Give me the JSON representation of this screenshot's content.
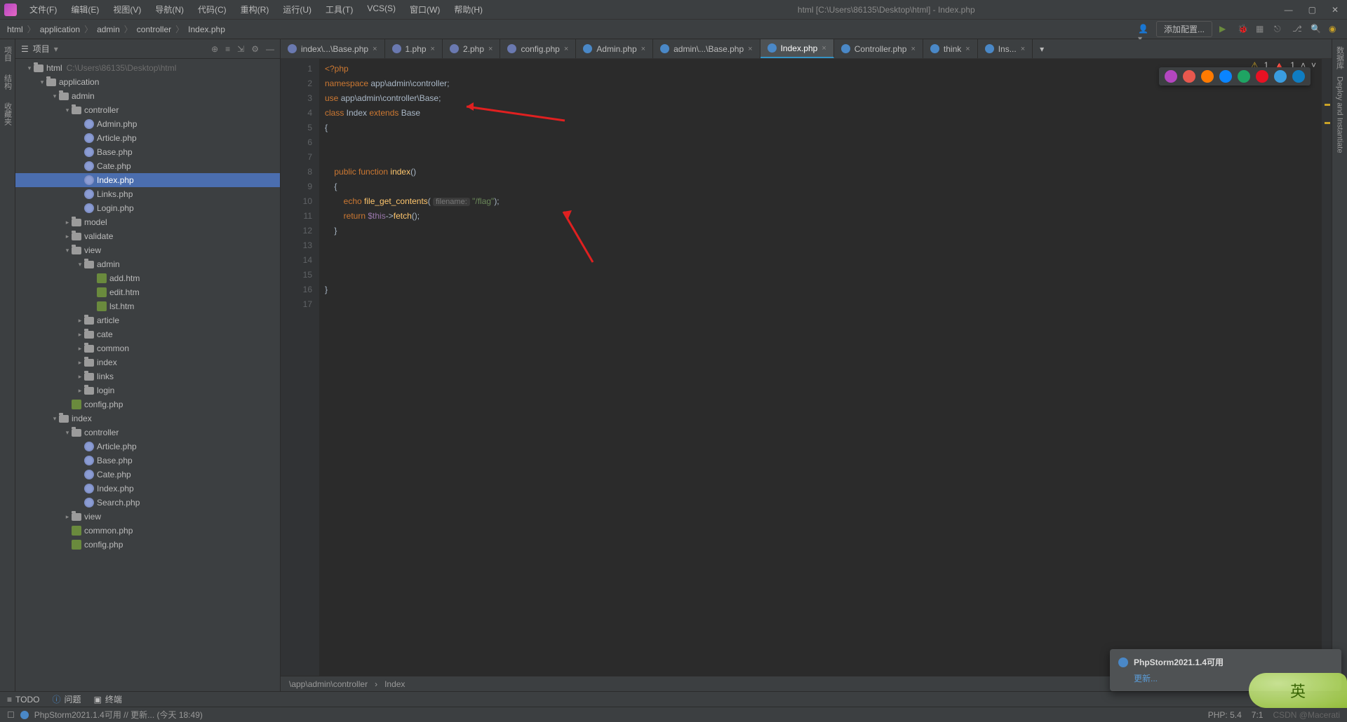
{
  "titlebar": {
    "menus": [
      "文件(F)",
      "编辑(E)",
      "视图(V)",
      "导航(N)",
      "代码(C)",
      "重构(R)",
      "运行(U)",
      "工具(T)",
      "VCS(S)",
      "窗口(W)",
      "帮助(H)"
    ],
    "title": "html [C:\\Users\\86135\\Desktop\\html] - Index.php"
  },
  "breadcrumb": [
    "html",
    "application",
    "admin",
    "controller",
    "Index.php"
  ],
  "navbar": {
    "config_btn": "添加配置..."
  },
  "project": {
    "header": "项目",
    "root_label": "html",
    "root_path": "C:\\Users\\86135\\Desktop\\html",
    "tree": [
      {
        "t": "folder",
        "l": "html",
        "d": 0,
        "open": true,
        "extra": "C:\\Users\\86135\\Desktop\\html"
      },
      {
        "t": "folder",
        "l": "application",
        "d": 1,
        "open": true
      },
      {
        "t": "folder",
        "l": "admin",
        "d": 2,
        "open": true
      },
      {
        "t": "folder",
        "l": "controller",
        "d": 3,
        "open": true
      },
      {
        "t": "php",
        "l": "Admin.php",
        "d": 4
      },
      {
        "t": "php",
        "l": "Article.php",
        "d": 4
      },
      {
        "t": "php",
        "l": "Base.php",
        "d": 4
      },
      {
        "t": "php",
        "l": "Cate.php",
        "d": 4
      },
      {
        "t": "php",
        "l": "Index.php",
        "d": 4,
        "sel": true
      },
      {
        "t": "php",
        "l": "Links.php",
        "d": 4
      },
      {
        "t": "php",
        "l": "Login.php",
        "d": 4
      },
      {
        "t": "folder",
        "l": "model",
        "d": 3,
        "open": false,
        "pre": ">"
      },
      {
        "t": "folder",
        "l": "validate",
        "d": 3,
        "open": false,
        "pre": ">"
      },
      {
        "t": "folder",
        "l": "view",
        "d": 3,
        "open": true
      },
      {
        "t": "folder",
        "l": "admin",
        "d": 4,
        "open": true
      },
      {
        "t": "htm",
        "l": "add.htm",
        "d": 5
      },
      {
        "t": "htm",
        "l": "edit.htm",
        "d": 5
      },
      {
        "t": "htm",
        "l": "lst.htm",
        "d": 5
      },
      {
        "t": "folder",
        "l": "article",
        "d": 4,
        "open": false,
        "pre": ">"
      },
      {
        "t": "folder",
        "l": "cate",
        "d": 4,
        "open": false,
        "pre": ">"
      },
      {
        "t": "folder",
        "l": "common",
        "d": 4,
        "open": false,
        "pre": ">"
      },
      {
        "t": "folder",
        "l": "index",
        "d": 4,
        "open": false,
        "pre": ">"
      },
      {
        "t": "folder",
        "l": "links",
        "d": 4,
        "open": false,
        "pre": ">"
      },
      {
        "t": "folder",
        "l": "login",
        "d": 4,
        "open": false,
        "pre": ">"
      },
      {
        "t": "htm",
        "l": "config.php",
        "d": 3
      },
      {
        "t": "folder",
        "l": "index",
        "d": 2,
        "open": true
      },
      {
        "t": "folder",
        "l": "controller",
        "d": 3,
        "open": true
      },
      {
        "t": "php",
        "l": "Article.php",
        "d": 4
      },
      {
        "t": "php",
        "l": "Base.php",
        "d": 4
      },
      {
        "t": "php",
        "l": "Cate.php",
        "d": 4
      },
      {
        "t": "php",
        "l": "Index.php",
        "d": 4
      },
      {
        "t": "php",
        "l": "Search.php",
        "d": 4
      },
      {
        "t": "folder",
        "l": "view",
        "d": 3,
        "open": false,
        "pre": ">"
      },
      {
        "t": "htm",
        "l": "common.php",
        "d": 3
      },
      {
        "t": "htm",
        "l": "config.php",
        "d": 3
      }
    ]
  },
  "tabs": [
    {
      "label": "index\\...\\Base.php",
      "icon": "php"
    },
    {
      "label": "1.php",
      "icon": "php"
    },
    {
      "label": "2.php",
      "icon": "php"
    },
    {
      "label": "config.php",
      "icon": "php"
    },
    {
      "label": "Admin.php",
      "icon": "cls"
    },
    {
      "label": "admin\\...\\Base.php",
      "icon": "cls"
    },
    {
      "label": "Index.php",
      "icon": "cls",
      "active": true
    },
    {
      "label": "Controller.php",
      "icon": "cls"
    },
    {
      "label": "think",
      "icon": "cls"
    },
    {
      "label": "Ins...",
      "icon": "cls"
    }
  ],
  "inspections": {
    "warn1": "1",
    "warn_icon": "⚠",
    "err1": "1",
    "up": "^",
    "down": "v"
  },
  "code": {
    "lines": [
      {
        "n": 1,
        "html": "<span class='kw'>&lt;?php</span>"
      },
      {
        "n": 2,
        "html": "<span class='kw'>namespace</span> app\\admin\\controller;"
      },
      {
        "n": 3,
        "html": "<span class='kw'>use</span> app\\admin\\controller\\Base;"
      },
      {
        "n": 4,
        "html": "<span class='kw'>class</span> Index <span class='kw'>extends</span> Base"
      },
      {
        "n": 5,
        "html": "{"
      },
      {
        "n": 6,
        "html": ""
      },
      {
        "n": 7,
        "html": ""
      },
      {
        "n": 8,
        "html": "    <span class='kw'>public</span> <span class='kw'>function</span> <span class='fn'>index</span>()"
      },
      {
        "n": 9,
        "html": "    {"
      },
      {
        "n": 10,
        "html": "        <span class='kw'>echo</span> <span class='fn'>file_get_contents</span>( <span class='hint'>filename:</span> <span class='str'>\"/flag\"</span>);"
      },
      {
        "n": 11,
        "html": "        <span class='kw'>return</span> <span class='var'>$this</span>-><span class='fn'>fetch</span>();"
      },
      {
        "n": 12,
        "html": "    }"
      },
      {
        "n": 13,
        "html": ""
      },
      {
        "n": 14,
        "html": ""
      },
      {
        "n": 15,
        "html": ""
      },
      {
        "n": 16,
        "html": "}"
      },
      {
        "n": 17,
        "html": ""
      }
    ]
  },
  "crumb2": [
    "\\app\\admin\\controller",
    "Index"
  ],
  "leftgutter": [
    "项目",
    "结构",
    "收藏夹"
  ],
  "rightgutter": [
    "数据库",
    "Deploy and Instantiate"
  ],
  "browsers": [
    "#b446c0",
    "#e8584e",
    "#ff7a00",
    "#0a84ff",
    "#1fa463",
    "#e81123",
    "#3a9de0",
    "#0f7dc2"
  ],
  "notif": {
    "title": "PhpStorm2021.1.4可用",
    "link": "更新..."
  },
  "toolwin": {
    "todo": "TODO",
    "problems": "问题",
    "terminal": "终端"
  },
  "status": {
    "msg": "PhpStorm2021.1.4可用 // 更新... (今天 18:49)",
    "right": [
      "PHP: 5.4",
      "7:1"
    ],
    "watermark": "CSDN @Macerati"
  },
  "ime": "英"
}
